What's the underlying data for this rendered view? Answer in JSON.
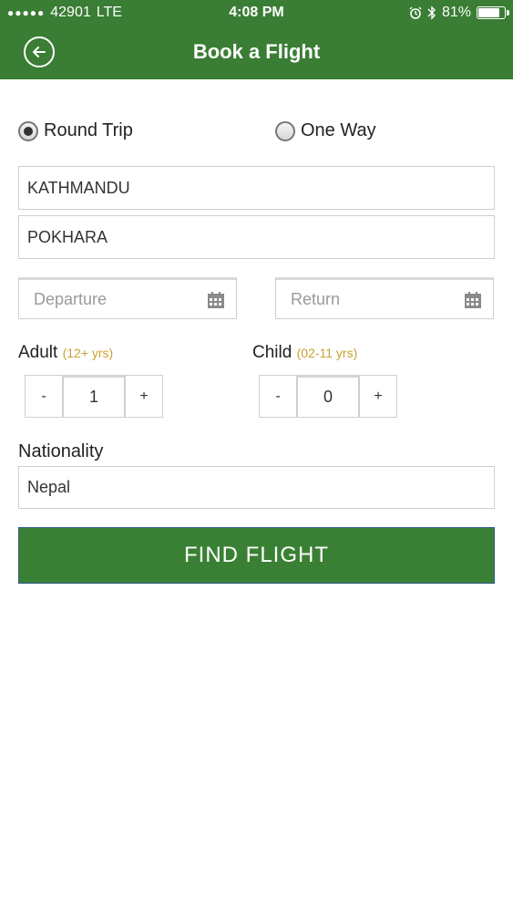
{
  "status_bar": {
    "carrier_dots": "●●●●●",
    "carrier": "42901",
    "network": "LTE",
    "time": "4:08 PM",
    "battery_percent": "81%",
    "battery_level": 0.81
  },
  "header": {
    "title": "Book a Flight",
    "color": "#3a7d34"
  },
  "trip_type": {
    "round_trip": "Round Trip",
    "one_way": "One Way",
    "selected": "round_trip"
  },
  "from_field": {
    "value": "KATHMANDU"
  },
  "to_field": {
    "value": "POKHARA"
  },
  "departure": {
    "placeholder": "Departure",
    "icon": "calendar-icon"
  },
  "return": {
    "placeholder": "Return",
    "icon": "calendar-icon"
  },
  "adult": {
    "label": "Adult",
    "hint": "(12+ yrs)",
    "minus": "-",
    "value": "1",
    "plus": "+"
  },
  "child": {
    "label": "Child",
    "hint": "(02-11 yrs)",
    "minus": "-",
    "value": "0",
    "plus": "+"
  },
  "nationality": {
    "label": "Nationality",
    "value": "Nepal"
  },
  "submit": {
    "label": "FIND FLIGHT",
    "color": "#3a8034"
  }
}
